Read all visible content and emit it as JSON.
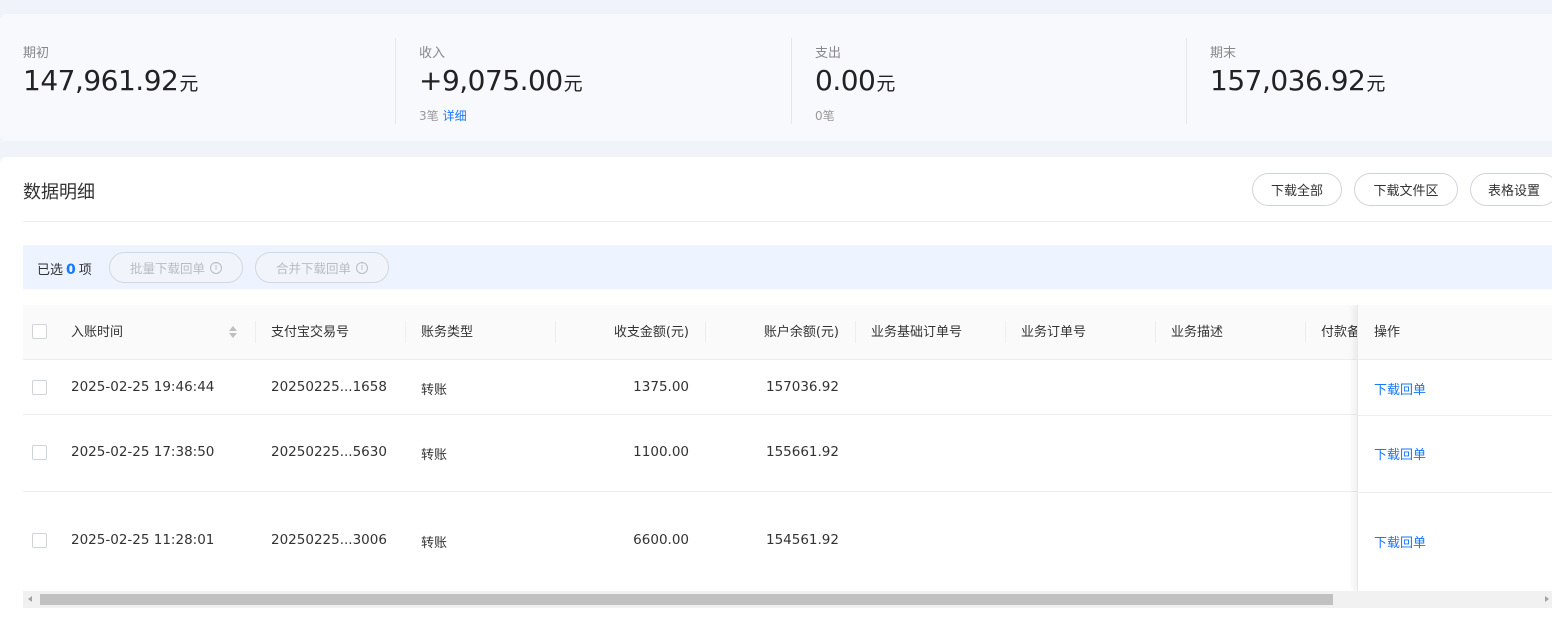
{
  "summary": {
    "opening": {
      "label": "期初",
      "value": "147,961.92",
      "unit": "元"
    },
    "income": {
      "label": "收入",
      "value": "+9,075.00",
      "unit": "元",
      "count": "3笔",
      "detail_link": "详细"
    },
    "expense": {
      "label": "支出",
      "value": "0.00",
      "unit": "元",
      "count": "0笔"
    },
    "closing": {
      "label": "期末",
      "value": "157,036.92",
      "unit": "元"
    }
  },
  "details": {
    "title": "数据明细",
    "buttons": {
      "download_all": "下载全部",
      "download_area": "下载文件区",
      "table_settings": "表格设置"
    }
  },
  "selection": {
    "prefix": "已选",
    "count": "0",
    "suffix": "项",
    "batch_download": "批量下载回单",
    "merge_download": "合并下载回单"
  },
  "table": {
    "columns": {
      "time": "入账时间",
      "trade_no": "支付宝交易号",
      "type": "账务类型",
      "amount": "收支金额(元)",
      "balance": "账户余额(元)",
      "base_order": "业务基础订单号",
      "order": "业务订单号",
      "desc": "业务描述",
      "remark": "付款备",
      "action": "操作"
    },
    "rows": [
      {
        "time": "2025-02-25 19:46:44",
        "trade_no": "20250225...1658",
        "type": "转账",
        "amount": "1375.00",
        "balance": "157036.92",
        "action": "下载回单"
      },
      {
        "time": "2025-02-25 17:38:50",
        "trade_no": "20250225...5630",
        "type": "转账",
        "amount": "1100.00",
        "balance": "155661.92",
        "action": "下载回单"
      },
      {
        "time": "2025-02-25 11:28:01",
        "trade_no": "20250225...3006",
        "type": "转账",
        "amount": "6600.00",
        "balance": "154561.92",
        "action": "下载回单"
      }
    ]
  },
  "colors": {
    "accent": "#1677ff",
    "select_bar": "#edf3ff",
    "page_bg": "#f0f3fa"
  },
  "icons": {
    "sort": "sort-icon",
    "info": "info-icon",
    "checkbox": "checkbox"
  }
}
